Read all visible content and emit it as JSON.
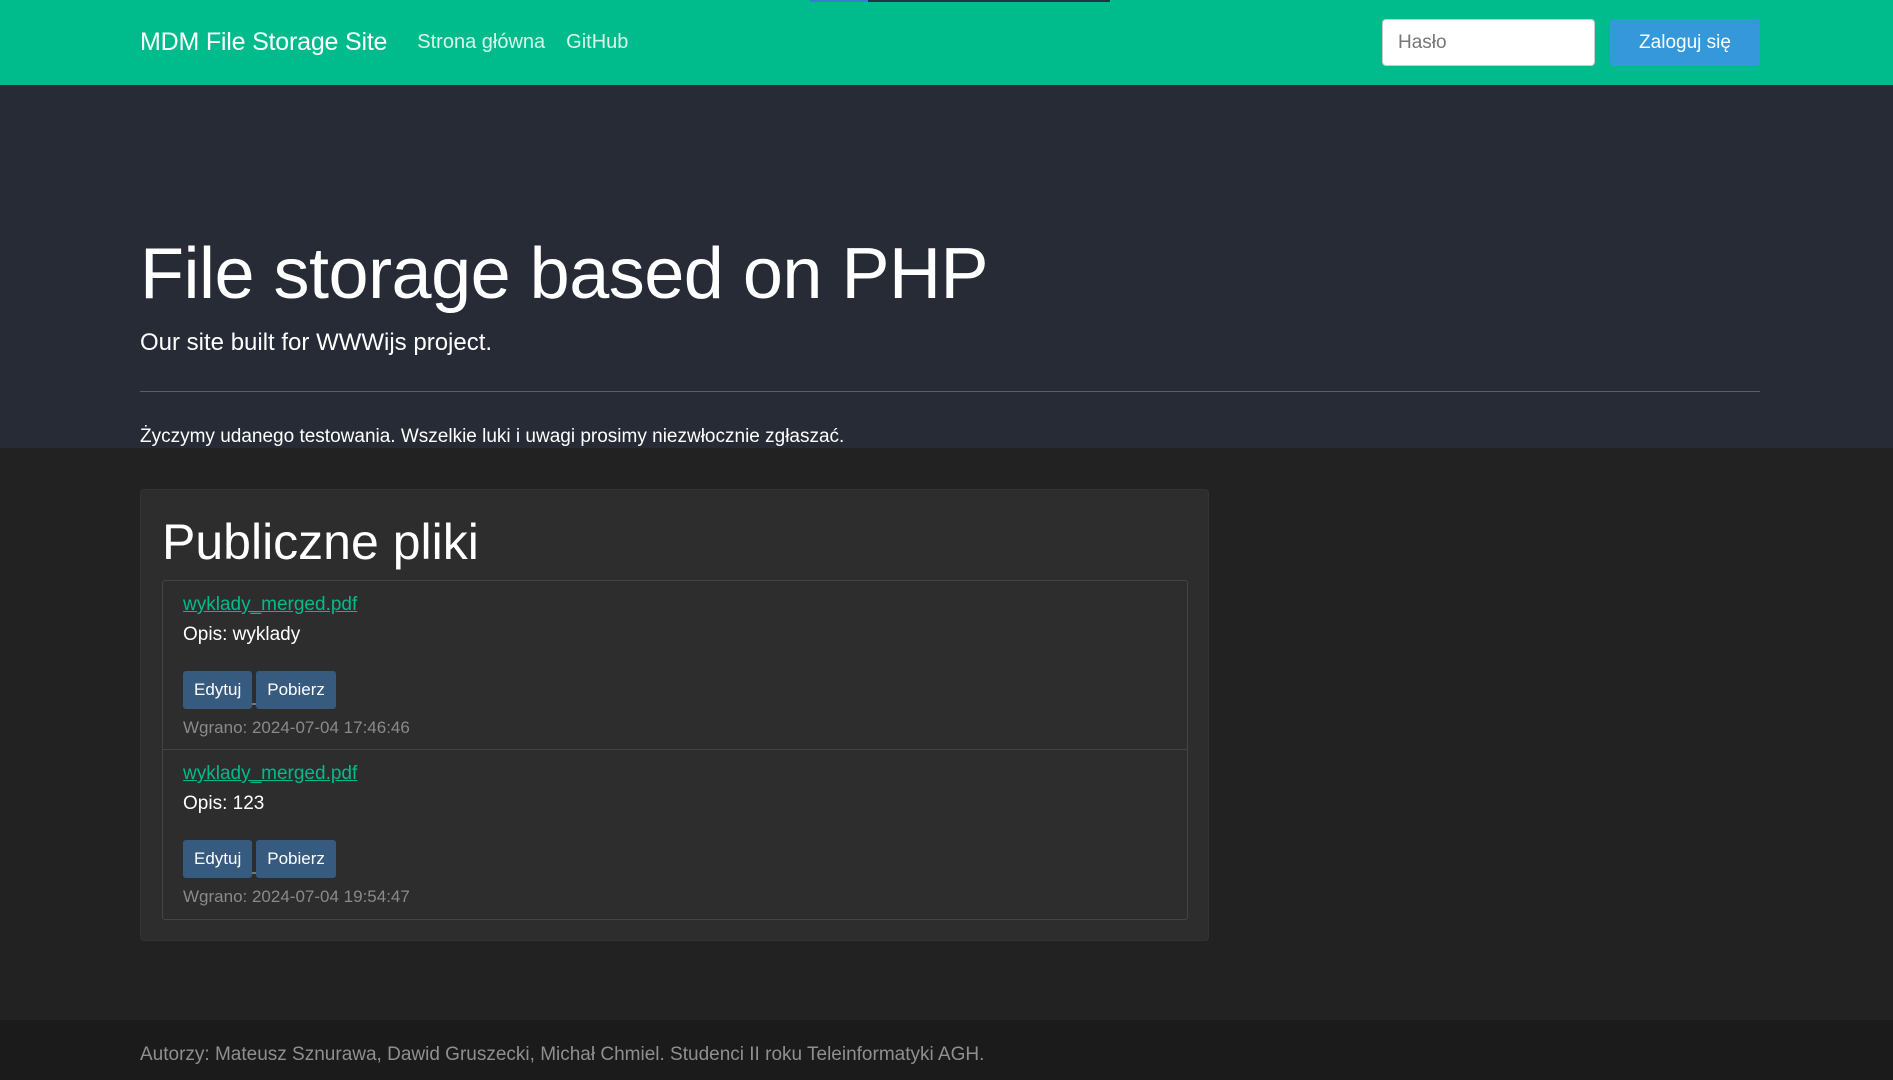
{
  "navbar": {
    "brand": "MDM File Storage Site",
    "links": [
      "Strona główna",
      "GitHub"
    ],
    "password_placeholder": "Hasło",
    "login_label": "Zaloguj się",
    "colors": {
      "background": "#00bc8c",
      "login_button": "#3498db"
    }
  },
  "jumbotron": {
    "title": "File storage based on PHP",
    "subtitle": "Our site built for WWWijs project.",
    "text": "Życzymy udanego testowania. Wszelkie luki i uwagi prosimy niezwłocznie zgłaszać."
  },
  "public_files": {
    "title": "Publiczne pliki",
    "items": [
      {
        "filename": "wyklady_merged.pdf",
        "description": "Opis: wyklady",
        "edit_label": "Edytuj",
        "download_label": "Pobierz",
        "uploaded": "Wgrano: 2024-07-04 17:46:46"
      },
      {
        "filename": "wyklady_merged.pdf",
        "description": "Opis: 123",
        "edit_label": "Edytuj",
        "download_label": "Pobierz",
        "uploaded": "Wgrano: 2024-07-04 19:54:47"
      }
    ]
  },
  "footer": {
    "text": "Autorzy: Mateusz Sznurawa, Dawid Gruszecki, Michał Chmiel. Studenci II roku Teleinformatyki AGH."
  }
}
